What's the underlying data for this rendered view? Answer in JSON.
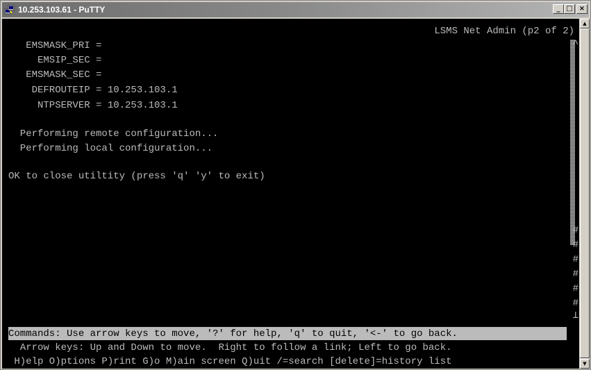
{
  "window": {
    "title": "10.253.103.61 - PuTTY",
    "controls": {
      "minimize": "_",
      "maximize": "□",
      "close": "×"
    }
  },
  "terminal": {
    "header_right": "LSMS Net Admin (p2 of 2)",
    "lines": [
      "   EMSMASK_PRI =",
      "     EMSIP_SEC =",
      "   EMSMASK_SEC =",
      "    DEFROUTEIP = 10.253.103.1",
      "     NTPSERVER = 10.253.103.1",
      "",
      "  Performing remote configuration...",
      "  Performing local configuration...",
      "",
      "OK to close utiltity (press 'q' 'y' to exit)"
    ],
    "status_highlight": "Commands: Use arrow keys to move, '?' for help, 'q' to quit, '<-' to go back.",
    "help_line_1": "  Arrow keys: Up and Down to move.  Right to follow a link; Left to go back.",
    "help_line_2": " H)elp O)ptions P)rint G)o M)ain screen Q)uit /=search [delete]=history list",
    "scroll_markers": [
      "^",
      "#",
      "#",
      "#",
      "#",
      "#",
      "#",
      "⊥"
    ]
  },
  "colors": {
    "terminal_bg": "#000000",
    "terminal_fg": "#bbbbbb",
    "highlight_bg": "#bbbbbb",
    "titlebar_text": "#ffffff"
  },
  "icons": {
    "app": "putty-icon",
    "scroll_up": "arrow-up-icon",
    "scroll_down": "arrow-down-icon"
  }
}
